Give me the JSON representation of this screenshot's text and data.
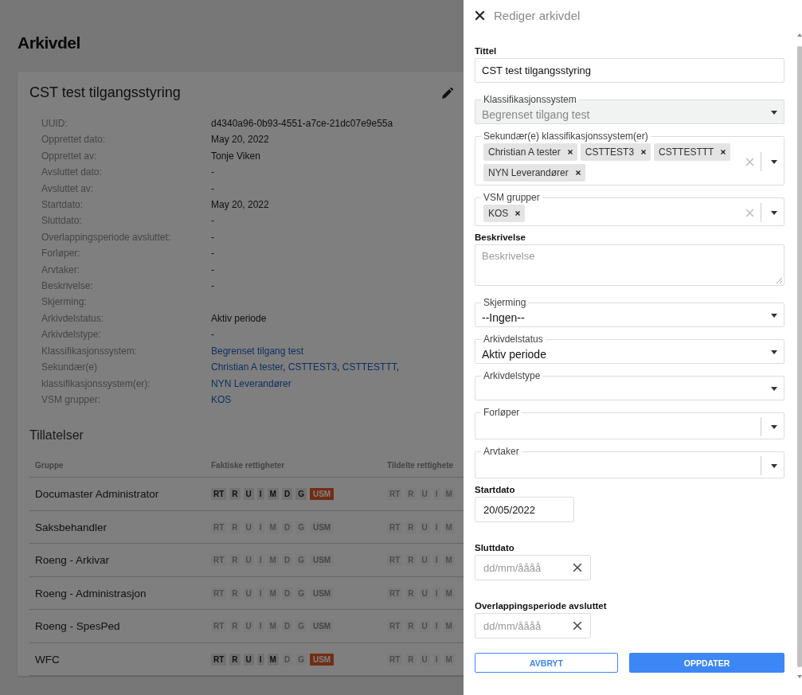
{
  "page": {
    "title": "Arkivdel"
  },
  "card": {
    "title": "CST test tilgangsstyring",
    "details": [
      {
        "label": "UUID:",
        "value": "d4340a96-0b93-4551-a7ce-21dc07e9e55a"
      },
      {
        "label": "Opprettet dato:",
        "value": "May 20, 2022"
      },
      {
        "label": "Opprettet av:",
        "value": "Tonje Viken"
      },
      {
        "label": "Avsluttet dato:",
        "value": "-"
      },
      {
        "label": "Avsluttet av:",
        "value": "-"
      },
      {
        "label": "Startdato:",
        "value": "May 20, 2022"
      },
      {
        "label": "Sluttdato:",
        "value": "-"
      },
      {
        "label": "Overlappingsperiode avsluttet:",
        "value": "-"
      },
      {
        "label": "Forløper:",
        "value": "-"
      },
      {
        "label": "Arvtaker:",
        "value": "-"
      },
      {
        "label": "Beskrivelse:",
        "value": "-"
      },
      {
        "label": "Skjerming:"
      },
      {
        "label": "Arkivdelstatus:",
        "value": "Aktiv periode"
      },
      {
        "label": "Arkivdelstype:",
        "value": "-"
      },
      {
        "label": "Klassifikasjonssystem:",
        "links": [
          {
            "text": "Begrenset tilgang test"
          }
        ]
      },
      {
        "label": "Sekundær(e) klassifikasjonssystem(er):",
        "links": [
          {
            "text": "Christian A tester",
            "separator": ","
          },
          {
            "text": "CSTTEST3",
            "separator": ","
          },
          {
            "text": "CSTTESTTT",
            "separator": ","
          },
          {
            "text": "NYN Leverandører"
          }
        ]
      },
      {
        "label": "VSM grupper:",
        "links": [
          {
            "text": "KOS"
          }
        ]
      }
    ]
  },
  "permissions": {
    "title": "Tillatelser",
    "columns": [
      "Gruppe",
      "Faktiske rettigheter",
      "Tildelte rettighete"
    ],
    "rows": [
      {
        "group": "Documaster Administrator",
        "actual": [
          {
            "code": "RT",
            "on": true,
            "kind": "right"
          },
          {
            "code": "R",
            "on": true,
            "kind": "right"
          },
          {
            "code": "U",
            "on": true,
            "kind": "right"
          },
          {
            "code": "I",
            "on": true,
            "kind": "right"
          },
          {
            "code": "M",
            "on": true,
            "kind": "right"
          },
          {
            "code": "D",
            "on": true,
            "kind": "right"
          },
          {
            "code": "G",
            "on": true,
            "kind": "right"
          },
          {
            "code": "USM",
            "on": true,
            "kind": "special"
          }
        ],
        "assigned": [
          {
            "code": "RT",
            "on": false,
            "kind": "right"
          },
          {
            "code": "R",
            "on": false,
            "kind": "right"
          },
          {
            "code": "U",
            "on": false,
            "kind": "right"
          },
          {
            "code": "I",
            "on": false,
            "kind": "right"
          },
          {
            "code": "M",
            "on": false,
            "kind": "right"
          }
        ]
      },
      {
        "group": "Saksbehandler",
        "actual": [
          {
            "code": "RT",
            "on": false,
            "kind": "right"
          },
          {
            "code": "R",
            "on": false,
            "kind": "right"
          },
          {
            "code": "U",
            "on": false,
            "kind": "right"
          },
          {
            "code": "I",
            "on": false,
            "kind": "right"
          },
          {
            "code": "M",
            "on": false,
            "kind": "right"
          },
          {
            "code": "D",
            "on": false,
            "kind": "right"
          },
          {
            "code": "G",
            "on": false,
            "kind": "right"
          },
          {
            "code": "USM",
            "on": false,
            "kind": "special"
          }
        ],
        "assigned": [
          {
            "code": "RT",
            "on": false,
            "kind": "right"
          },
          {
            "code": "R",
            "on": false,
            "kind": "right"
          },
          {
            "code": "U",
            "on": false,
            "kind": "right"
          },
          {
            "code": "I",
            "on": false,
            "kind": "right"
          },
          {
            "code": "M",
            "on": false,
            "kind": "right"
          }
        ]
      },
      {
        "group": "Roeng - Arkivar",
        "actual": [
          {
            "code": "RT",
            "on": false,
            "kind": "right"
          },
          {
            "code": "R",
            "on": false,
            "kind": "right"
          },
          {
            "code": "U",
            "on": false,
            "kind": "right"
          },
          {
            "code": "I",
            "on": false,
            "kind": "right"
          },
          {
            "code": "M",
            "on": false,
            "kind": "right"
          },
          {
            "code": "D",
            "on": false,
            "kind": "right"
          },
          {
            "code": "G",
            "on": false,
            "kind": "right"
          },
          {
            "code": "USM",
            "on": false,
            "kind": "special"
          }
        ],
        "assigned": [
          {
            "code": "RT",
            "on": false,
            "kind": "right"
          },
          {
            "code": "R",
            "on": false,
            "kind": "right"
          },
          {
            "code": "U",
            "on": false,
            "kind": "right"
          },
          {
            "code": "I",
            "on": false,
            "kind": "right"
          },
          {
            "code": "M",
            "on": false,
            "kind": "right"
          }
        ]
      },
      {
        "group": "Roeng - Administrasjon",
        "actual": [
          {
            "code": "RT",
            "on": false,
            "kind": "right"
          },
          {
            "code": "R",
            "on": false,
            "kind": "right"
          },
          {
            "code": "U",
            "on": false,
            "kind": "right"
          },
          {
            "code": "I",
            "on": false,
            "kind": "right"
          },
          {
            "code": "M",
            "on": false,
            "kind": "right"
          },
          {
            "code": "D",
            "on": false,
            "kind": "right"
          },
          {
            "code": "G",
            "on": false,
            "kind": "right"
          },
          {
            "code": "USM",
            "on": false,
            "kind": "special"
          }
        ],
        "assigned": [
          {
            "code": "RT",
            "on": false,
            "kind": "right"
          },
          {
            "code": "R",
            "on": false,
            "kind": "right"
          },
          {
            "code": "U",
            "on": false,
            "kind": "right"
          },
          {
            "code": "I",
            "on": false,
            "kind": "right"
          },
          {
            "code": "M",
            "on": false,
            "kind": "right"
          }
        ]
      },
      {
        "group": "Roeng - SpesPed",
        "actual": [
          {
            "code": "RT",
            "on": false,
            "kind": "right"
          },
          {
            "code": "R",
            "on": false,
            "kind": "right"
          },
          {
            "code": "U",
            "on": false,
            "kind": "right"
          },
          {
            "code": "I",
            "on": false,
            "kind": "right"
          },
          {
            "code": "M",
            "on": false,
            "kind": "right"
          },
          {
            "code": "D",
            "on": false,
            "kind": "right"
          },
          {
            "code": "G",
            "on": false,
            "kind": "right"
          },
          {
            "code": "USM",
            "on": false,
            "kind": "special"
          }
        ],
        "assigned": [
          {
            "code": "RT",
            "on": false,
            "kind": "right"
          },
          {
            "code": "R",
            "on": false,
            "kind": "right"
          },
          {
            "code": "U",
            "on": false,
            "kind": "right"
          },
          {
            "code": "I",
            "on": false,
            "kind": "right"
          },
          {
            "code": "M",
            "on": false,
            "kind": "right"
          }
        ]
      },
      {
        "group": "WFC",
        "actual": [
          {
            "code": "RT",
            "on": true,
            "kind": "right"
          },
          {
            "code": "R",
            "on": true,
            "kind": "right"
          },
          {
            "code": "U",
            "on": true,
            "kind": "right"
          },
          {
            "code": "I",
            "on": true,
            "kind": "right"
          },
          {
            "code": "M",
            "on": true,
            "kind": "right"
          },
          {
            "code": "D",
            "on": false,
            "kind": "right"
          },
          {
            "code": "G",
            "on": false,
            "kind": "right"
          },
          {
            "code": "USM",
            "on": true,
            "kind": "special"
          }
        ],
        "assigned": [
          {
            "code": "RT",
            "on": false,
            "kind": "right"
          },
          {
            "code": "R",
            "on": false,
            "kind": "right"
          },
          {
            "code": "U",
            "on": false,
            "kind": "right"
          },
          {
            "code": "I",
            "on": false,
            "kind": "right"
          },
          {
            "code": "M",
            "on": false,
            "kind": "right"
          }
        ]
      }
    ]
  },
  "drawer": {
    "title": "Rediger arkivdel",
    "fields": [
      {
        "kind": "text",
        "label": "Tittel",
        "value": "CST test tilgangsstyring"
      },
      {
        "kind": "select",
        "label": "Klassifikasjonssystem",
        "value": "Begrenset tilgang test",
        "disabled": true
      },
      {
        "kind": "multiselect",
        "label": "Sekundær(e) klassifikasjonssystem(er)",
        "tags": [
          "Christian A tester",
          "CSTTEST3",
          "CSTTESTTT",
          "NYN Leverandører"
        ]
      },
      {
        "kind": "multiselect",
        "label": "VSM grupper",
        "tags": [
          "KOS"
        ]
      },
      {
        "kind": "textarea",
        "label": "Beskrivelse",
        "placeholder": "Beskrivelse"
      },
      {
        "kind": "select",
        "label": "Skjerming",
        "value": "--Ingen--",
        "disabled": false
      },
      {
        "kind": "select",
        "label": "Arkivdelstatus",
        "value": "Aktiv periode",
        "disabled": false
      },
      {
        "kind": "select",
        "label": "Arkivdelstype",
        "disabled": false
      },
      {
        "kind": "lookup",
        "label": "Forløper"
      },
      {
        "kind": "lookup",
        "label": "Arvtaker"
      },
      {
        "kind": "date",
        "label": "Startdato",
        "value": "20/05/2022",
        "clearable": false
      },
      {
        "kind": "date",
        "label": "Sluttdato",
        "placeholder": "dd/mm/åååå",
        "clearable": true
      },
      {
        "kind": "date",
        "label": "Overlappingsperiode avsluttet",
        "placeholder": "dd/mm/åååå",
        "clearable": true
      }
    ],
    "buttons": [
      {
        "label": "AVBRYT",
        "kind": "secondary"
      },
      {
        "label": "OPPDATER",
        "kind": "primary"
      }
    ]
  }
}
